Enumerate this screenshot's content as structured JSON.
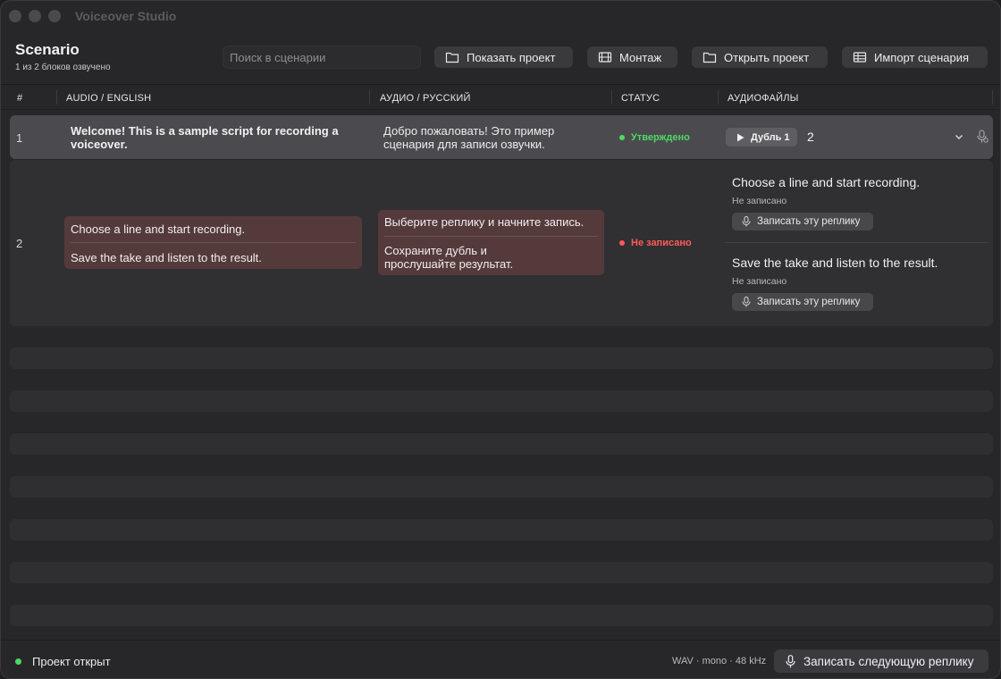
{
  "app": {
    "title": "Voiceover Studio"
  },
  "header": {
    "title": "Scenario",
    "progress": "1 из 2 блоков озвучено",
    "search_placeholder": "Поиск в сценарии",
    "buttons": {
      "show_project": "Показать проект",
      "montage": "Монтаж",
      "open_project": "Открыть проект",
      "import_script": "Импорт сценария"
    }
  },
  "columns": {
    "num": "#",
    "english": "AUDIO / ENGLISH",
    "russian": "АУДИО / РУССКИЙ",
    "status": "СТАТУС",
    "files": "АУДИОФАЙЛЫ"
  },
  "rows": [
    {
      "num": "1",
      "en": "Welcome! This is a sample script for recording a voiceover.",
      "ru": "Добро пожаловать! Это пример сценария для записи озвучки.",
      "status": "Утверждено",
      "take_label": "Дубль 1",
      "take_count": "2"
    },
    {
      "num": "2",
      "en": [
        "Choose a line and start recording.",
        "Save the take and listen to the result."
      ],
      "ru": [
        "Выберите реплику и начните запись.",
        "Сохраните дубль и прослушайте результат."
      ],
      "status": "Не записано",
      "files": [
        {
          "title": "Choose a line and start recording.",
          "state": "Не записано",
          "record_label": "Записать эту реплику"
        },
        {
          "title": "Save the take and listen to the result.",
          "state": "Не записано",
          "record_label": "Записать эту реплику"
        }
      ]
    }
  ],
  "colors": {
    "approved": "#4cd964",
    "not_recorded": "#ff5a55",
    "line_highlight": "#553a3b"
  },
  "footer": {
    "status": "Проект открыт",
    "format": "WAV · mono · 48 kHz",
    "record_next": "Записать следующую реплику"
  }
}
